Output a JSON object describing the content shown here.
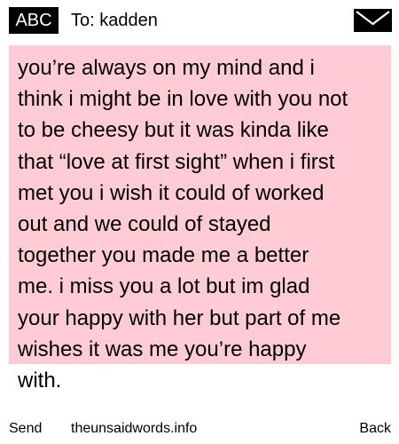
{
  "header": {
    "input_mode": "ABC",
    "to_label": "To: kadden",
    "icon": "envelope-icon"
  },
  "message": {
    "text": "you’re always on my mind and i\nthink i might be in love with you not\nto be cheesy but it was kinda like\nthat “love at first sight” when i first\nmet you i wish it could of worked\nout and we could of stayed\ntogether you made me a better\nme. i miss you a lot but im glad\nyour happy with her but part of me\nwishes it was me you’re happy\nwith.",
    "background_color": "#ffccd5"
  },
  "footer": {
    "send_label": "Send",
    "site_label": "theunsaidwords.info",
    "back_label": "Back"
  }
}
